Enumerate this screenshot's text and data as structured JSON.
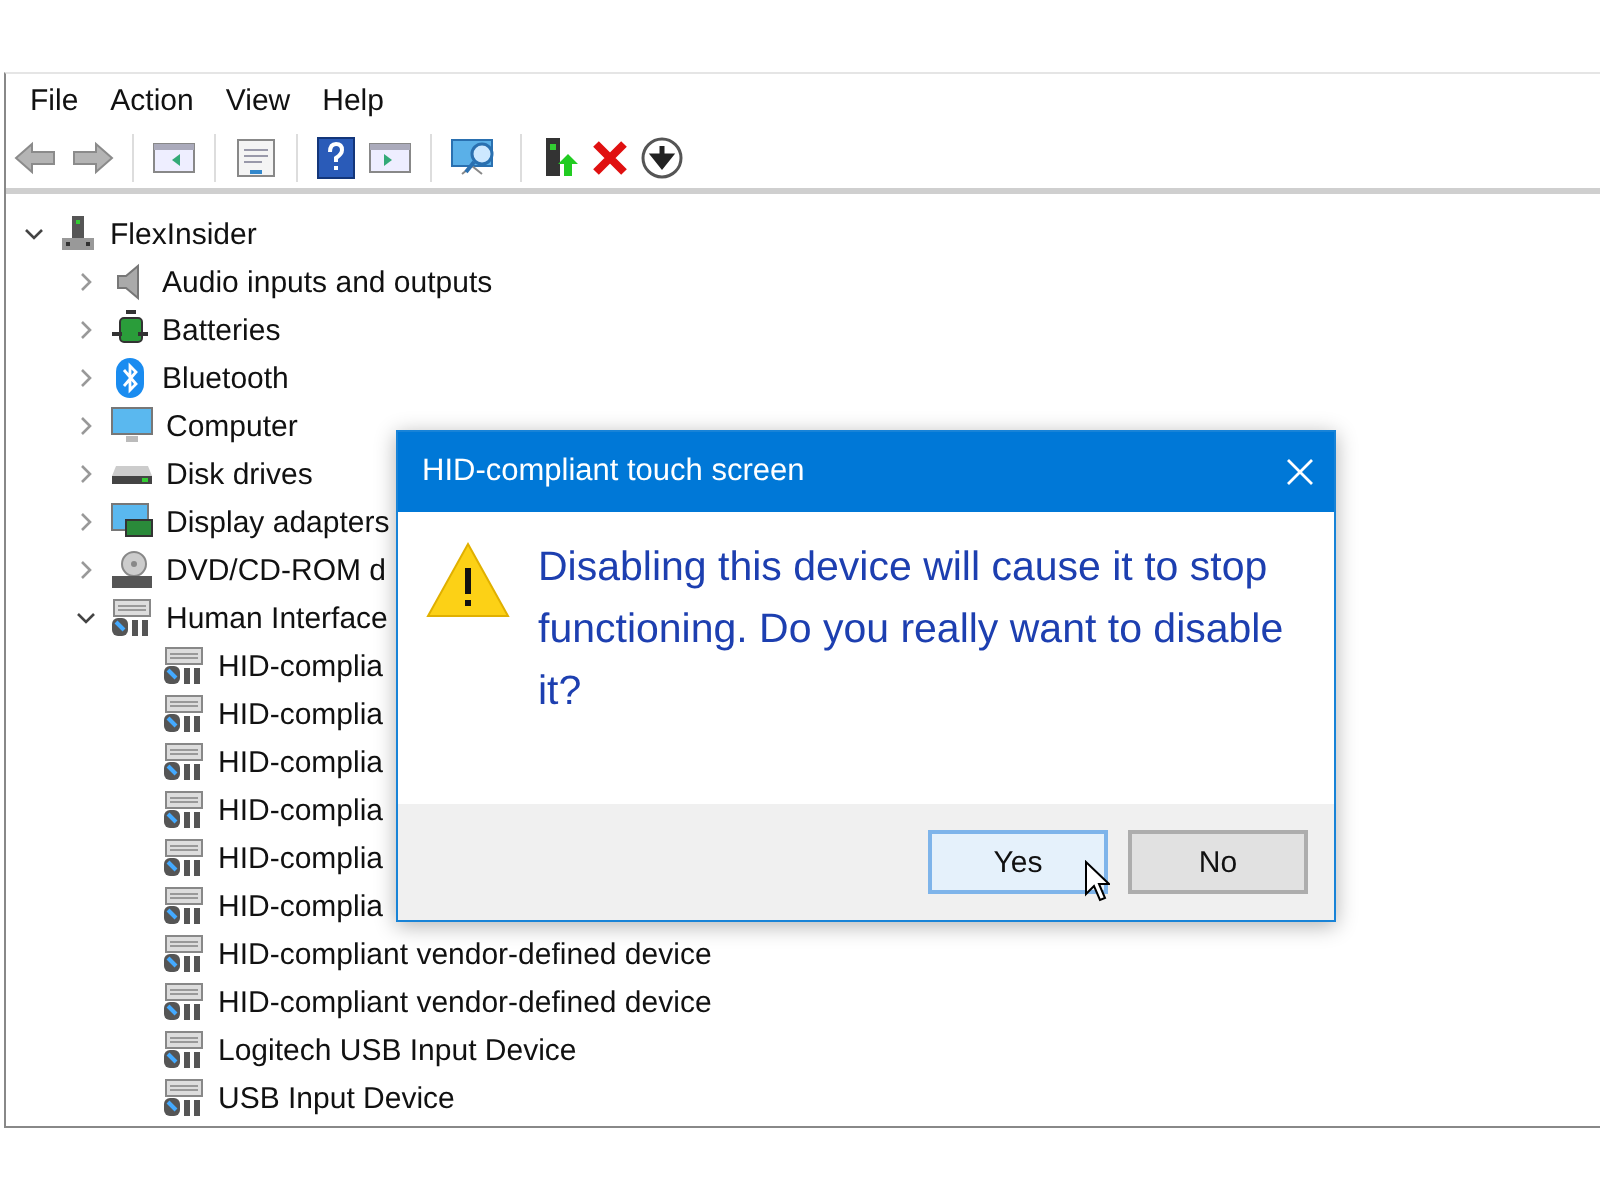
{
  "menu": [
    {
      "label": "File"
    },
    {
      "label": "Action"
    },
    {
      "label": "View"
    },
    {
      "label": "Help"
    }
  ],
  "toolbar": [
    {
      "kind": "back",
      "disabled": true
    },
    {
      "kind": "forward",
      "disabled": true
    },
    {
      "kind": "sep"
    },
    {
      "kind": "tree-pane",
      "disabled": false
    },
    {
      "kind": "sep"
    },
    {
      "kind": "properties",
      "disabled": false
    },
    {
      "kind": "sep"
    },
    {
      "kind": "help",
      "disabled": false
    },
    {
      "kind": "action-pane",
      "disabled": false
    },
    {
      "kind": "sep"
    },
    {
      "kind": "scan",
      "disabled": false
    },
    {
      "kind": "sep"
    },
    {
      "kind": "update",
      "disabled": false
    },
    {
      "kind": "uninstall",
      "disabled": false
    },
    {
      "kind": "disable",
      "disabled": false
    }
  ],
  "tree": {
    "label": "FlexInsider",
    "kind": "computer-root",
    "expanded": true,
    "children": [
      {
        "label": "Audio inputs and outputs",
        "kind": "speaker",
        "expanded": false
      },
      {
        "label": "Batteries",
        "kind": "battery",
        "expanded": false
      },
      {
        "label": "Bluetooth",
        "kind": "bluetooth",
        "expanded": false
      },
      {
        "label": "Computer",
        "kind": "monitor",
        "expanded": false
      },
      {
        "label": "Disk drives",
        "kind": "disk",
        "expanded": false
      },
      {
        "label": "Display adapters",
        "kind": "display",
        "expanded": false
      },
      {
        "label": "DVD/CD-ROM d",
        "kind": "dvd",
        "expanded": false
      },
      {
        "label": "Human Interface",
        "kind": "hid",
        "expanded": true,
        "children": [
          {
            "label": "HID-complia",
            "kind": "hid"
          },
          {
            "label": "HID-complia",
            "kind": "hid"
          },
          {
            "label": "HID-complia",
            "kind": "hid"
          },
          {
            "label": "HID-complia",
            "kind": "hid"
          },
          {
            "label": "HID-complia",
            "kind": "hid"
          },
          {
            "label": "HID-complia",
            "kind": "hid"
          },
          {
            "label": "HID-compliant vendor-defined device",
            "kind": "hid"
          },
          {
            "label": "HID-compliant vendor-defined device",
            "kind": "hid"
          },
          {
            "label": "Logitech USB Input Device",
            "kind": "hid"
          },
          {
            "label": "USB Input Device",
            "kind": "hid"
          }
        ]
      }
    ]
  },
  "dialog": {
    "title": "HID-compliant touch screen",
    "message": "Disabling this device will cause it to stop functioning. Do you really want to disable it?",
    "buttons": [
      {
        "label": "Yes",
        "selected": true
      },
      {
        "label": "No",
        "selected": false
      }
    ]
  }
}
